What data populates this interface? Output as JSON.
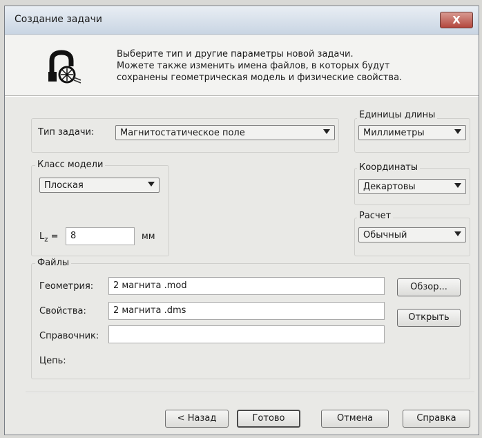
{
  "window": {
    "title": "Создание задачи",
    "close_label": "X"
  },
  "header": {
    "icon": "magnet-coil-icon",
    "lines": [
      "Выберите тип и другие параметры новой задачи.",
      "Можете также изменить имена файлов, в которых будут",
      "сохранены геометрическая модель и физические свойства."
    ]
  },
  "task_type": {
    "label": "Тип задачи:",
    "value": "Магнитостатическое поле"
  },
  "length_units": {
    "label": "Единицы длины",
    "value": "Миллиметры"
  },
  "model_class": {
    "label": "Класс модели",
    "value": "Плоская"
  },
  "coordinates": {
    "label": "Координаты",
    "value": "Декартовы"
  },
  "calculation": {
    "label": "Расчет",
    "value": "Обычный"
  },
  "lz": {
    "label": "L",
    "subscript": "z",
    "eq": "=",
    "value": "8",
    "unit": "мм"
  },
  "files": {
    "label": "Файлы",
    "geometry": {
      "label": "Геометрия:",
      "value": "2 магнита .mod"
    },
    "properties": {
      "label": "Свойства:",
      "value": "2 магнита .dms"
    },
    "reference": {
      "label": "Справочник:",
      "value": ""
    },
    "circuit": {
      "label": "Цепь:"
    },
    "browse_label": "Обзор...",
    "open_label": "Открыть"
  },
  "footer": {
    "back_label": "< Назад",
    "done_label": "Готово",
    "cancel_label": "Отмена",
    "help_label": "Справка"
  }
}
